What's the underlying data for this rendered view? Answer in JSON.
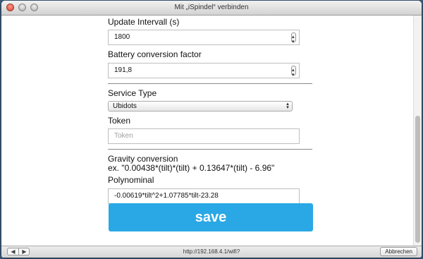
{
  "window": {
    "title": "Mit „iSpindel“ verbinden"
  },
  "form": {
    "update_interval": {
      "label": "Update Intervall (s)",
      "value": "1800"
    },
    "battery_factor": {
      "label": "Battery conversion factor",
      "value": "191,8"
    },
    "service_type": {
      "label": "Service Type",
      "selected": "Ubidots"
    },
    "token": {
      "label": "Token",
      "placeholder": "Token"
    },
    "gravity": {
      "label": "Gravity conversion",
      "example": "ex. \"0.00438*(tilt)*(tilt) + 0.13647*(tilt) - 6.96\""
    },
    "polynominal": {
      "label": "Polynominal",
      "value": "-0.00619*tilt^2+1.07785*tilt-23.28"
    },
    "save_label": "save"
  },
  "statusbar": {
    "url": "http://192.168.4.1/wifi?",
    "cancel_label": "Abbrechen"
  },
  "colors": {
    "save_button": "#2aa8e6",
    "background": "#3c5a78"
  }
}
